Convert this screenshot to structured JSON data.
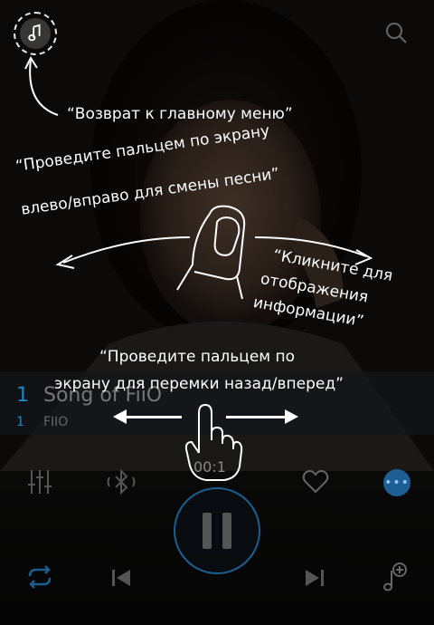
{
  "player": {
    "track_number": "1",
    "track_sub": "1",
    "song_title": "Song of FiiO",
    "artist": "FIIO",
    "time": "00:1"
  },
  "tutorial": {
    "home_hint": "“Возврат к главному меню”",
    "swipe_hint_line1": "“Проведите пальцем по экрану",
    "swipe_hint_line2": "влево/вправо для смены песни”",
    "tap_hint_line1": "“Кликните для",
    "tap_hint_line2": "отображения",
    "tap_hint_line3": "информации”",
    "seek_hint_line1": "“Проведите пальцем по",
    "seek_hint_line2": "экрану для перемки назад/вперед”"
  },
  "icons": {
    "home": "music-note-icon",
    "search": "search-icon",
    "equalizer": "equalizer-icon",
    "bluetooth": "bluetooth-icon",
    "favorite": "heart-icon",
    "more": "more-icon",
    "play_pause": "pause-icon",
    "repeat": "repeat-icon",
    "previous": "previous-icon",
    "next": "next-icon",
    "add_to_playlist": "add-to-playlist-icon"
  },
  "colors": {
    "accent": "#1f86c4",
    "accent_dark": "#1d5f95"
  }
}
